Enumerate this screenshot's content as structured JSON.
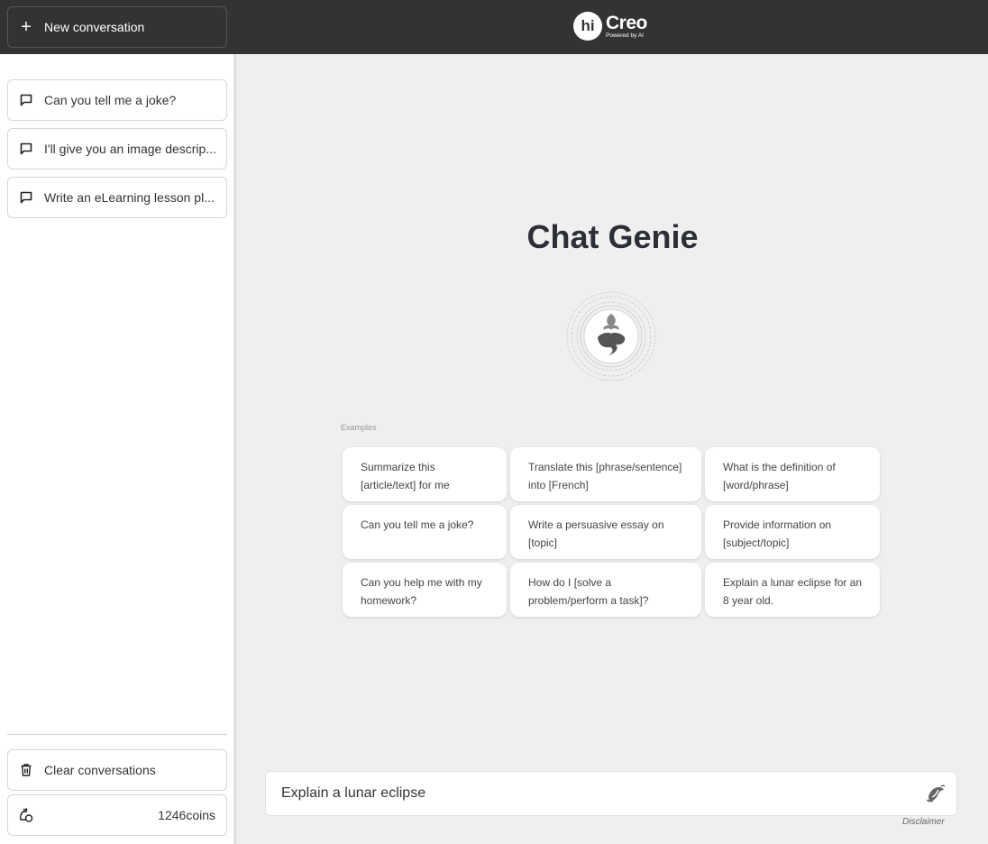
{
  "header": {
    "new_conversation_label": "New conversation",
    "logo": {
      "mark": "hi",
      "name": "Creo",
      "tagline": "Powered by AI"
    }
  },
  "sidebar": {
    "conversations": [
      {
        "label": "Can you tell me a joke?",
        "icon": "chat-bubble-icon"
      },
      {
        "label": "I'll give you an image descrip...",
        "icon": "chat-bubble-icon"
      },
      {
        "label": "Write an eLearning lesson pl...",
        "icon": "chat-bubble-icon"
      }
    ],
    "clear_label": "Clear conversations",
    "coins_label": "1246coins"
  },
  "main": {
    "title": "Chat Genie",
    "examples_label": "Examples",
    "examples": [
      "Summarize this [article/text] for me",
      "Translate this [phrase/sentence] into [French]",
      "What is the definition of [word/phrase]",
      "Can you tell me a joke?",
      "Write a persuasive essay on [topic]",
      "Provide information on [subject/topic]",
      "Can you help me with my homework?",
      "How do I [solve a problem/perform a task]?",
      "Explain a lunar eclipse for an 8 year old."
    ],
    "input_value": "Explain a lunar eclipse",
    "disclaimer": "Disclaimer"
  }
}
